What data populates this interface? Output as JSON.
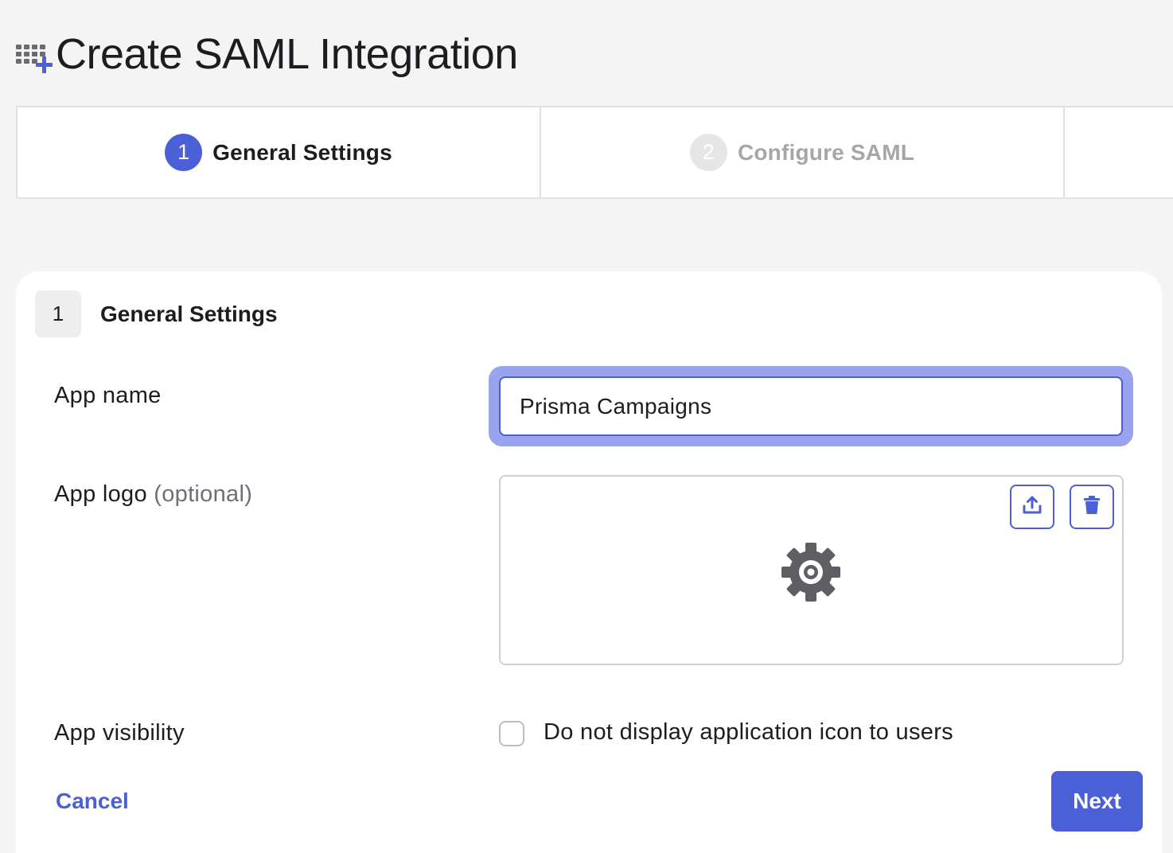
{
  "header": {
    "icon": "grid-plus-icon",
    "title": "Create SAML Integration"
  },
  "stepper": {
    "steps": [
      {
        "number": "1",
        "label": "General Settings",
        "state": "active"
      },
      {
        "number": "2",
        "label": "Configure SAML",
        "state": "inactive"
      }
    ]
  },
  "section": {
    "number": "1",
    "title": "General Settings"
  },
  "form": {
    "app_name": {
      "label": "App name",
      "value": "Prisma Campaigns"
    },
    "app_logo": {
      "label": "App logo",
      "optional_label": "(optional)",
      "upload_icon": "upload-icon",
      "delete_icon": "trash-icon",
      "preview_icon": "gear-icon"
    },
    "app_visibility": {
      "label": "App visibility",
      "checkbox_label": "Do not display application icon to users",
      "checked": false
    }
  },
  "actions": {
    "cancel_label": "Cancel",
    "next_label": "Next"
  },
  "colors": {
    "accent": "#4b5fd6",
    "focus_ring": "#9aa4ee",
    "background": "#f4f4f4",
    "surface": "#ffffff",
    "muted_text": "#a6a6a6"
  }
}
